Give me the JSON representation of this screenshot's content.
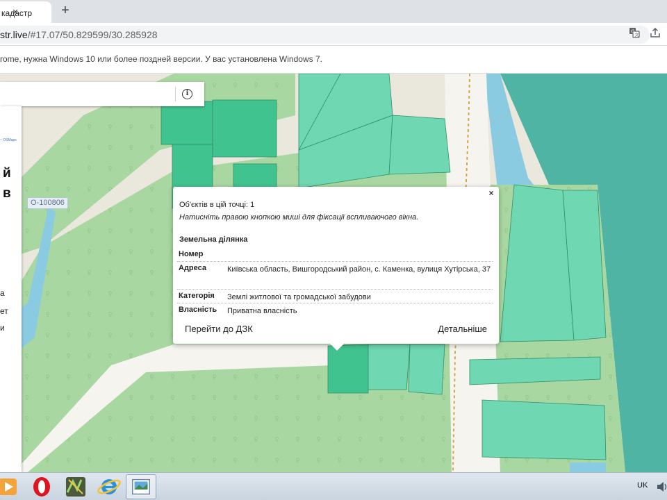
{
  "browser": {
    "tab_title": "кадастр",
    "tab_close": "×",
    "new_tab": "+",
    "url_host": "str.live",
    "url_path": "/#17.07/50.829599/30.285928",
    "translate_icon": "translate-icon",
    "share_icon": "share-icon"
  },
  "infobar": {
    "text": "rome, нужна Windows 10 или более поздней версии. У вас установлена Windows 7."
  },
  "map": {
    "search": {
      "value": "",
      "info_icon": "info-icon",
      "info_glyph": "i"
    },
    "road_label": "О-100806",
    "side_panel": {
      "tiny_text": "~ OSMaps",
      "big_letters": [
        "й",
        "в"
      ],
      "small_letters": [
        "а",
        "ет",
        "и"
      ]
    },
    "colors": {
      "forest": "#a9d7a1",
      "parcel": "#6fd7b1",
      "parcel_dark": "#41c38f",
      "water": "#8bcbe2",
      "teal_zone": "#4fb4a4"
    }
  },
  "popup": {
    "close": "×",
    "objects_count": "Об'єктів в цій точці: 1",
    "hint": "Натисніть правою кнопкою миші для фіксації вспливаючого вікна.",
    "section_title": "Земельна ділянка",
    "rows": [
      {
        "key": "Номер",
        "value": ""
      },
      {
        "key": "Адреса",
        "value": "Київська область, Вишгородський район, с. Каменка, вулиця Хутірська, 37"
      },
      {
        "key": "Категорія",
        "value": "Землі житлової та громадської забудови"
      },
      {
        "key": "Власність",
        "value": "Приватна власність"
      }
    ],
    "goto_dzk": "Перейти до ДЗК",
    "details": "Детальніше"
  },
  "taskbar": {
    "apps": [
      "media-player-icon",
      "opera-icon",
      "winamp-icon",
      "internet-explorer-icon",
      "photo-viewer-icon"
    ],
    "language": "UK",
    "volume_icon": "volume-icon"
  }
}
